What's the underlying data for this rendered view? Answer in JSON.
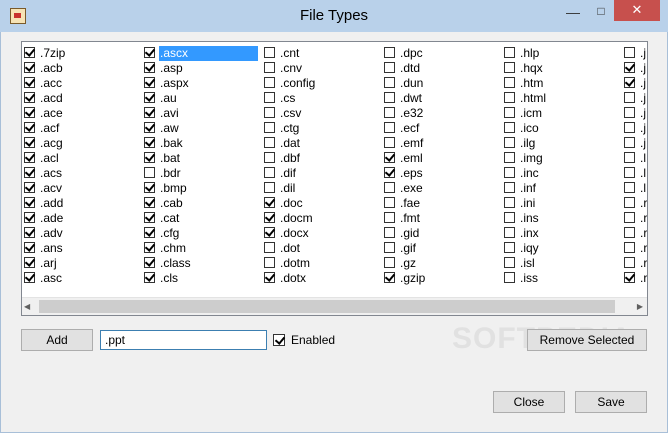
{
  "window": {
    "title": "File Types",
    "minimize_icon": "minimize-icon",
    "maximize_icon": "maximize-icon",
    "close_icon": "close-icon"
  },
  "list": {
    "columns": [
      [
        {
          "ext": ".7zip",
          "checked": true
        },
        {
          "ext": ".acb",
          "checked": true
        },
        {
          "ext": ".acc",
          "checked": true
        },
        {
          "ext": ".acd",
          "checked": true
        },
        {
          "ext": ".ace",
          "checked": true
        },
        {
          "ext": ".acf",
          "checked": true
        },
        {
          "ext": ".acg",
          "checked": true
        },
        {
          "ext": ".acl",
          "checked": true
        },
        {
          "ext": ".acs",
          "checked": true
        },
        {
          "ext": ".acv",
          "checked": true
        },
        {
          "ext": ".add",
          "checked": true
        },
        {
          "ext": ".ade",
          "checked": true
        },
        {
          "ext": ".adv",
          "checked": true
        },
        {
          "ext": ".ans",
          "checked": true
        },
        {
          "ext": ".arj",
          "checked": true
        },
        {
          "ext": ".asc",
          "checked": true
        }
      ],
      [
        {
          "ext": ".ascx",
          "checked": true,
          "selected": true
        },
        {
          "ext": ".asp",
          "checked": true
        },
        {
          "ext": ".aspx",
          "checked": true
        },
        {
          "ext": ".au",
          "checked": true
        },
        {
          "ext": ".avi",
          "checked": true
        },
        {
          "ext": ".aw",
          "checked": true
        },
        {
          "ext": ".bak",
          "checked": true
        },
        {
          "ext": ".bat",
          "checked": true
        },
        {
          "ext": ".bdr",
          "checked": false
        },
        {
          "ext": ".bmp",
          "checked": true
        },
        {
          "ext": ".cab",
          "checked": true
        },
        {
          "ext": ".cat",
          "checked": true
        },
        {
          "ext": ".cfg",
          "checked": true
        },
        {
          "ext": ".chm",
          "checked": true
        },
        {
          "ext": ".class",
          "checked": true
        },
        {
          "ext": ".cls",
          "checked": true
        }
      ],
      [
        {
          "ext": ".cnt",
          "checked": false
        },
        {
          "ext": ".cnv",
          "checked": false
        },
        {
          "ext": ".config",
          "checked": false
        },
        {
          "ext": ".cs",
          "checked": false
        },
        {
          "ext": ".csv",
          "checked": false
        },
        {
          "ext": ".ctg",
          "checked": false
        },
        {
          "ext": ".dat",
          "checked": false
        },
        {
          "ext": ".dbf",
          "checked": false
        },
        {
          "ext": ".dif",
          "checked": false
        },
        {
          "ext": ".dil",
          "checked": false
        },
        {
          "ext": ".doc",
          "checked": true
        },
        {
          "ext": ".docm",
          "checked": true
        },
        {
          "ext": ".docx",
          "checked": true
        },
        {
          "ext": ".dot",
          "checked": false
        },
        {
          "ext": ".dotm",
          "checked": false
        },
        {
          "ext": ".dotx",
          "checked": true
        }
      ],
      [
        {
          "ext": ".dpc",
          "checked": false
        },
        {
          "ext": ".dtd",
          "checked": false
        },
        {
          "ext": ".dun",
          "checked": false
        },
        {
          "ext": ".dwt",
          "checked": false
        },
        {
          "ext": ".e32",
          "checked": false
        },
        {
          "ext": ".ecf",
          "checked": false
        },
        {
          "ext": ".emf",
          "checked": false
        },
        {
          "ext": ".eml",
          "checked": true
        },
        {
          "ext": ".eps",
          "checked": true
        },
        {
          "ext": ".exe",
          "checked": false
        },
        {
          "ext": ".fae",
          "checked": false
        },
        {
          "ext": ".fmt",
          "checked": false
        },
        {
          "ext": ".gid",
          "checked": false
        },
        {
          "ext": ".gif",
          "checked": false
        },
        {
          "ext": ".gz",
          "checked": false
        },
        {
          "ext": ".gzip",
          "checked": true
        }
      ],
      [
        {
          "ext": ".hlp",
          "checked": false
        },
        {
          "ext": ".hqx",
          "checked": false
        },
        {
          "ext": ".htm",
          "checked": false
        },
        {
          "ext": ".html",
          "checked": false
        },
        {
          "ext": ".icm",
          "checked": false
        },
        {
          "ext": ".ico",
          "checked": false
        },
        {
          "ext": ".ilg",
          "checked": false
        },
        {
          "ext": ".img",
          "checked": false
        },
        {
          "ext": ".inc",
          "checked": false
        },
        {
          "ext": ".inf",
          "checked": false
        },
        {
          "ext": ".ini",
          "checked": false
        },
        {
          "ext": ".ins",
          "checked": false
        },
        {
          "ext": ".inx",
          "checked": false
        },
        {
          "ext": ".iqy",
          "checked": false
        },
        {
          "ext": ".isl",
          "checked": false
        },
        {
          "ext": ".iss",
          "checked": false
        }
      ],
      [
        {
          "ext": ".j",
          "checked": false
        },
        {
          "ext": ".j",
          "checked": true
        },
        {
          "ext": ".j",
          "checked": true
        },
        {
          "ext": ".j",
          "checked": false
        },
        {
          "ext": ".j",
          "checked": false
        },
        {
          "ext": ".j",
          "checked": false
        },
        {
          "ext": ".j",
          "checked": false
        },
        {
          "ext": ".l",
          "checked": false
        },
        {
          "ext": ".l",
          "checked": false
        },
        {
          "ext": ".l",
          "checked": false
        },
        {
          "ext": ".r",
          "checked": false
        },
        {
          "ext": ".r",
          "checked": false
        },
        {
          "ext": ".r",
          "checked": false
        },
        {
          "ext": ".r",
          "checked": false
        },
        {
          "ext": ".r",
          "checked": false
        },
        {
          "ext": ".r",
          "checked": true
        }
      ]
    ]
  },
  "scrollbar": {
    "left_icon": "scroll-left-icon",
    "right_icon": "scroll-right-icon"
  },
  "controls": {
    "add_label": "Add",
    "extension_value": ".ppt",
    "enabled_label": "Enabled",
    "enabled_checked": true,
    "remove_label": "Remove Selected",
    "close_label": "Close",
    "save_label": "Save"
  },
  "watermark": "SOFTPEDIA"
}
